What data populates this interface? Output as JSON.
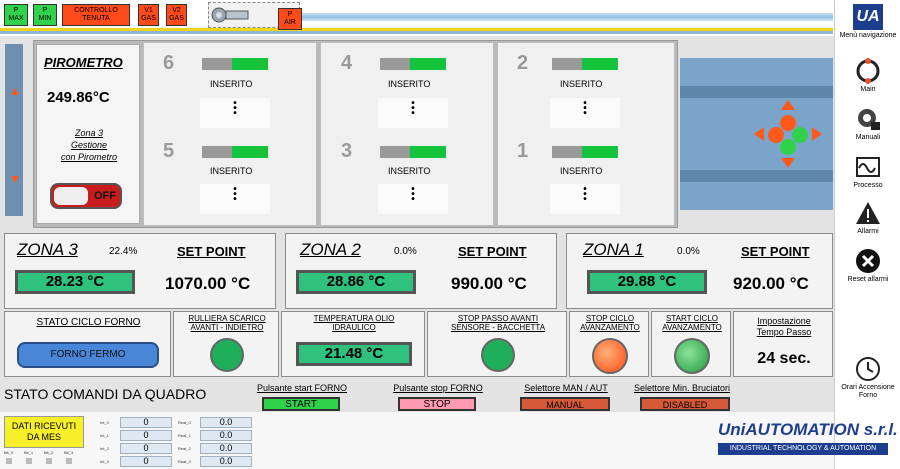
{
  "top": {
    "indicators": [
      {
        "label": "P\nMAX",
        "color": "#2fd24a"
      },
      {
        "label": "P\nMIN",
        "color": "#2fd24a"
      },
      {
        "label": "CONTROLLO\nTENUTA",
        "color": "#ff4a1a"
      },
      {
        "label": "V1\nGAS",
        "color": "#ff4a1a"
      },
      {
        "label": "V2\nGAS",
        "color": "#ff4a1a"
      },
      {
        "label": "P\nAIR",
        "color": "#ff4a1a"
      }
    ]
  },
  "sidebar": {
    "logo_text": "UA",
    "items": [
      {
        "label": "Menù navigazione",
        "icon": "logo-icon"
      },
      {
        "label": "Main",
        "icon": "refresh-icon"
      },
      {
        "label": "Manuali",
        "icon": "gear-lock-icon"
      },
      {
        "label": "Processo",
        "icon": "wave-icon"
      },
      {
        "label": "Allarmi",
        "icon": "warning-icon"
      },
      {
        "label": "Reset allarmi",
        "icon": "close-circle-icon"
      },
      {
        "label": "Orari Accensione Forno",
        "icon": "clock-icon"
      }
    ]
  },
  "pyrometer": {
    "title": "PIROMETRO",
    "value": "249.86°C",
    "desc": "Zona 3\nGestione\ncon Pirometro",
    "toggle": "OFF"
  },
  "burners": [
    {
      "num": "6",
      "status": "INSERITO"
    },
    {
      "num": "5",
      "status": "INSERITO"
    },
    {
      "num": "4",
      "status": "INSERITO"
    },
    {
      "num": "3",
      "status": "INSERITO"
    },
    {
      "num": "2",
      "status": "INSERITO"
    },
    {
      "num": "1",
      "status": "INSERITO"
    }
  ],
  "zones": [
    {
      "title": "ZONA 3",
      "pct": "22.4%",
      "temp": "28.23 °C",
      "sp_label": "SET POINT",
      "sp_value": "1070.00 °C"
    },
    {
      "title": "ZONA 2",
      "pct": "0.0%",
      "temp": "28.86 °C",
      "sp_label": "SET POINT",
      "sp_value": "990.00 °C"
    },
    {
      "title": "ZONA 1",
      "pct": "0.0%",
      "temp": "29.88 °C",
      "sp_label": "SET POINT",
      "sp_value": "920.00 °C"
    }
  ],
  "row2": {
    "stato_ciclo_label": "STATO CICLO FORNO",
    "stato_ciclo_value": "FORNO FERMO",
    "rulliera_label": "RULLIERA SCARICO\nAVANTI - INDIETRO",
    "temp_olio_label": "TEMPERATURA OLIO\nIDRAULICO",
    "temp_olio_value": "21.48 °C",
    "stop_passo_label": "STOP PASSO AVANTI\nSENSORE - BACCHETTA",
    "stop_ciclo_label": "STOP CICLO\nAVANZAMENTO",
    "start_ciclo_label": "START CICLO\nAVANZAMENTO",
    "impostazione_label": "Impostazione\nTempo Passo",
    "impostazione_value": "24 sec."
  },
  "commands": {
    "title": "STATO COMANDI DA QUADRO",
    "start_label": "Pulsante start FORNO",
    "start_btn": "START",
    "stop_label": "Pulsante stop FORNO",
    "stop_btn": "STOP",
    "man_label": "Selettore MAN / AUT",
    "man_btn": "MANUAL",
    "bruc_label": "Selettore Min. Bruciatori",
    "bruc_btn": "DISABLED"
  },
  "bottom": {
    "mes_label": "DATI RICEVUTI\nDA MES",
    "small_labels": [
      "Bit_0",
      "Bit_1",
      "Bit_2",
      "Bit_3"
    ],
    "int_labels": [
      "Int_0",
      "Int_1",
      "Int_2",
      "Int_3"
    ],
    "int_values": [
      "0",
      "0",
      "0",
      "0"
    ],
    "real_labels": [
      "Real_0",
      "Real_1",
      "Real_2",
      "Real_3"
    ],
    "real_values": [
      "0.0",
      "0.0",
      "0.0",
      "0.0"
    ],
    "brand": "UniAUTOMATION s.r.l.",
    "brand_sub": "INDUSTRIAL TECHNOLOGY & AUTOMATION"
  }
}
